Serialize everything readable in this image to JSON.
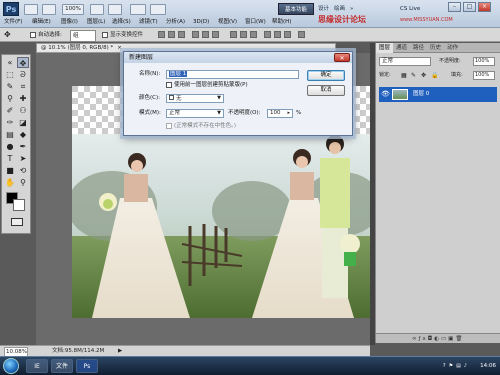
{
  "menubar": {
    "logo": "Ps",
    "items": [
      "文件(F)",
      "编辑(E)",
      "图像(I)",
      "图层(L)",
      "选择(S)",
      "滤镜(T)",
      "分析(A)",
      "3D(D)",
      "视图(V)",
      "窗口(W)",
      "帮助(H)"
    ],
    "zoom_value": "100%",
    "workspace_button": "基本功能",
    "workspace_links": [
      "设计",
      "绘画",
      "»"
    ],
    "cs_live": "CS Live",
    "watermark": "思缘设计论坛",
    "watermark_url": "www.MISSYUAN.COM"
  },
  "options_bar": {
    "auto_select_label": "自动选择:",
    "auto_select_value": "组",
    "show_transform_label": "显示变换控件"
  },
  "document": {
    "tab_title": "@ 10.1% (图层 0, RGB/8) *",
    "status_zoom": "10.08%",
    "status_doc": "文档:95.8M/114.2M"
  },
  "dialog": {
    "title": "新建图层",
    "name_label": "名称(N):",
    "name_value": "图层 1",
    "clip_label": "使用前一图层创建剪贴蒙版(P)",
    "color_label": "颜色(C):",
    "color_value": "无",
    "mode_label": "模式(M):",
    "mode_value": "正常",
    "opacity_label": "不透明度(O):",
    "opacity_value": "100",
    "opacity_unit": "%",
    "neutral_label": "(正常模式不存在中性色。)",
    "ok_label": "确定",
    "cancel_label": "取消"
  },
  "layers_panel": {
    "tabs": [
      "图层",
      "通道",
      "路径",
      "历史",
      "动作"
    ],
    "blend_mode": "正常",
    "opacity_label": "不透明度:",
    "opacity_value": "100%",
    "fill_label": "填充:",
    "fill_value": "100%",
    "lock_label": "锁定:",
    "layer_name": "图层 0"
  },
  "taskbar": {
    "task_icons": [
      "IE",
      "文件",
      "Ps"
    ],
    "clock": "14:06"
  },
  "colors": {
    "accent": "#1f5fbd",
    "checker_light": "#ffffff",
    "checker_dark": "#cccccc"
  }
}
